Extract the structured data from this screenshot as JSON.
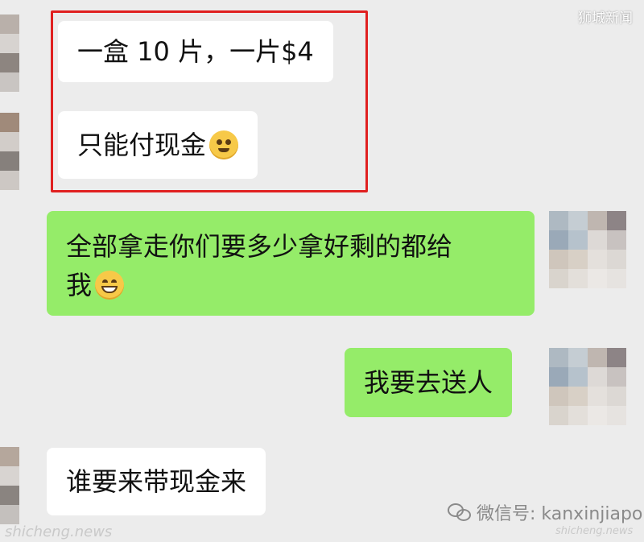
{
  "watermark_top": "狮城新闻",
  "messages": {
    "m1": "一盒 10 片，一片$4",
    "m2": "只能付现金",
    "m3_line1": "全部拿走你们要多少拿好剩的都给",
    "m3_line2": "我",
    "m4": "我要去送人",
    "m5": "谁要来带现金来"
  },
  "footer": {
    "wechat_label": "微信号: kanxinjiapo",
    "site_left": "shicheng.news",
    "site_right": "shicheng.news"
  },
  "colors": {
    "highlight": "#e02020",
    "green_bubble": "#95ec69"
  },
  "icons": [
    "blush-emoji-icon",
    "grin-emoji-icon",
    "wechat-icon"
  ]
}
